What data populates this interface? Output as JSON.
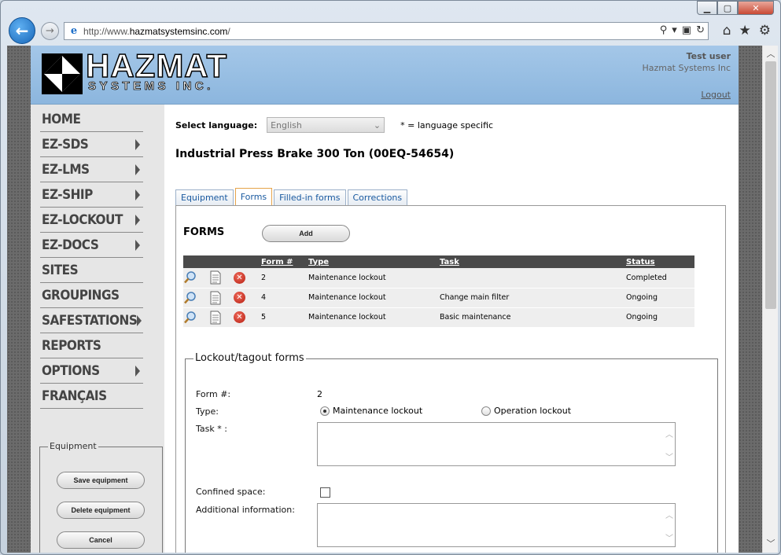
{
  "browser": {
    "url_prefix": "http://www.",
    "url_domain": "hazmatsystemsinc.com",
    "url_suffix": "/",
    "window_min": "▁",
    "window_max": "▢",
    "window_close": "✕"
  },
  "header": {
    "logo_title": "HAZMAT",
    "logo_subtitle": "SYSTEMS INC.",
    "user_name": "Test user",
    "user_org": "Hazmat Systems Inc",
    "logout": "Logout"
  },
  "nav": {
    "items": [
      {
        "label": "HOME",
        "has_submenu": false
      },
      {
        "label": "EZ-SDS",
        "has_submenu": true
      },
      {
        "label": "EZ-LMS",
        "has_submenu": true
      },
      {
        "label": "EZ-SHIP",
        "has_submenu": true
      },
      {
        "label": "EZ-LOCKOUT",
        "has_submenu": true
      },
      {
        "label": "EZ-DOCS",
        "has_submenu": true
      },
      {
        "label": "SITES",
        "has_submenu": false
      },
      {
        "label": "GROUPINGS",
        "has_submenu": false
      },
      {
        "label": "SAFESTATIONS",
        "has_submenu": true
      },
      {
        "label": "REPORTS",
        "has_submenu": false
      },
      {
        "label": "OPTIONS",
        "has_submenu": true
      },
      {
        "label": "FRANÇAIS",
        "has_submenu": false
      }
    ]
  },
  "equipment_box": {
    "legend": "Equipment",
    "save": "Save equipment",
    "delete": "Delete equipment",
    "cancel": "Cancel"
  },
  "language": {
    "label": "Select language:",
    "selected": "English",
    "note": "* = language specific"
  },
  "equipment_title": "Industrial Press Brake 300 Ton (00EQ-54654)",
  "tabs": [
    {
      "label": "Equipment",
      "active": false
    },
    {
      "label": "Forms",
      "active": true
    },
    {
      "label": "Filled-in forms",
      "active": false
    },
    {
      "label": "Corrections",
      "active": false
    }
  ],
  "forms": {
    "title": "FORMS",
    "add_button": "Add",
    "columns": {
      "form_no": "Form #",
      "type": "Type",
      "task": "Task",
      "status": "Status"
    },
    "rows": [
      {
        "form_no": "2",
        "type": "Maintenance lockout",
        "task": "",
        "status": "Completed"
      },
      {
        "form_no": "4",
        "type": "Maintenance lockout",
        "task": "Change main filter",
        "status": "Ongoing"
      },
      {
        "form_no": "5",
        "type": "Maintenance lockout",
        "task": "Basic maintenance",
        "status": "Ongoing"
      }
    ]
  },
  "lockout": {
    "legend": "Lockout/tagout forms",
    "form_no_label": "Form #:",
    "form_no_value": "2",
    "type_label": "Type:",
    "type_option_1": "Maintenance lockout",
    "type_option_2": "Operation lockout",
    "type_selected": "Maintenance lockout",
    "task_label": "Task * :",
    "confined_label": "Confined space:",
    "confined_checked": false,
    "additional_label": "Additional information:"
  }
}
